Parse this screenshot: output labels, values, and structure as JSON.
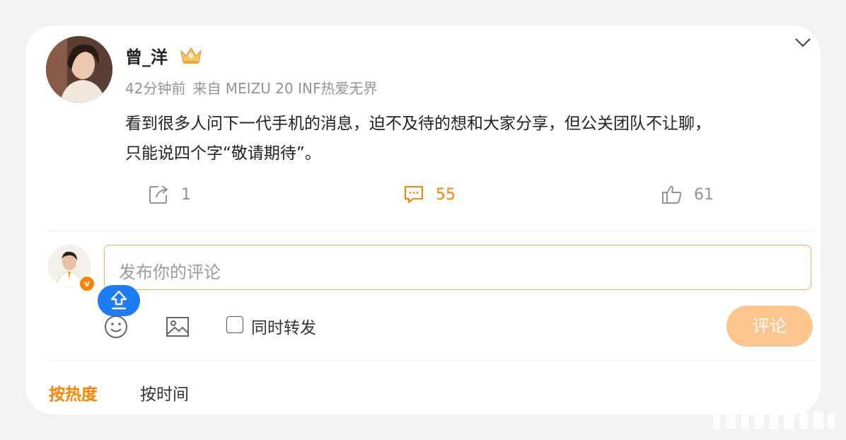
{
  "post": {
    "author": "曾_洋",
    "time": "42分钟前",
    "source": "来自 MEIZU 20 INF热爱无界",
    "text_line1": "看到很多人问下一代手机的消息，迫不及待的想和大家分享，但公关团队不让聊，",
    "text_line2": "只能说四个字“敬请期待”。"
  },
  "actions": {
    "repost_count": "1",
    "comment_count": "55",
    "like_count": "61"
  },
  "comment_box": {
    "placeholder": "发布你的评论",
    "repost_label": "同时转发",
    "submit_label": "评论"
  },
  "sort": {
    "hot_label": "按热度",
    "time_label": "按时间"
  },
  "colors": {
    "accent": "#ff8200",
    "submit_bg": "#fdc58e",
    "float_button": "#1c7cf4"
  },
  "icons": {
    "collapse": "chevron-down-icon",
    "repost": "repost-icon",
    "comment": "comment-icon",
    "like": "thumbs-up-icon",
    "emoji": "emoji-icon",
    "image": "image-icon",
    "float": "arrow-up-icon",
    "verified": "verified-badge-icon",
    "crown": "crown-icon"
  }
}
